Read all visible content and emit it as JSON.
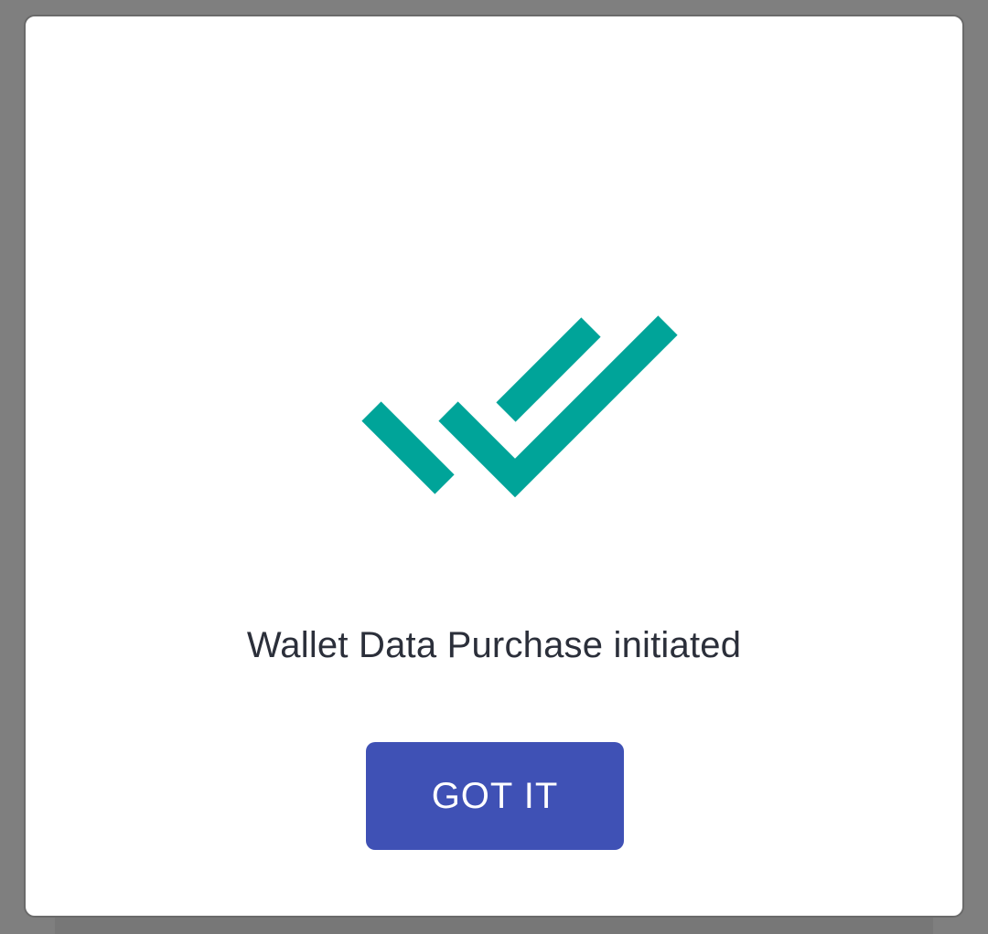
{
  "dialog": {
    "icon": "double-check-icon",
    "message": "Wallet Data Purchase initiated",
    "button_label": "GOT IT"
  },
  "colors": {
    "accent": "#00a499",
    "button": "#3f51b5",
    "text": "#2b2f3a",
    "scrim": "#7f7f7f"
  }
}
